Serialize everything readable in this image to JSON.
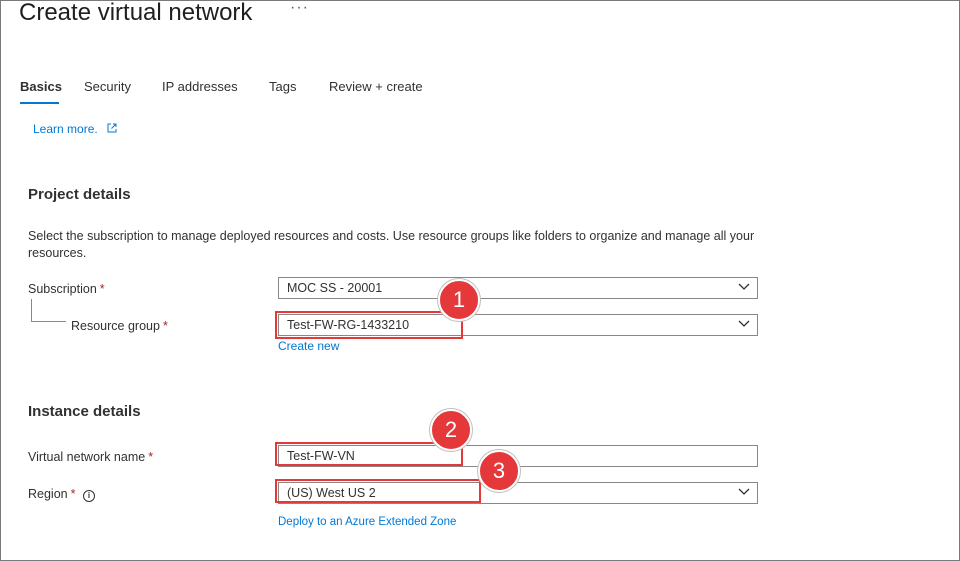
{
  "header": {
    "title": "Create virtual network",
    "more": "···"
  },
  "tabs": [
    {
      "label": "Basics",
      "active": true
    },
    {
      "label": "Security"
    },
    {
      "label": "IP addresses"
    },
    {
      "label": "Tags"
    },
    {
      "label": "Review + create"
    }
  ],
  "learn_more": "Learn more.",
  "project": {
    "heading": "Project details",
    "description": "Select the subscription to manage deployed resources and costs. Use resource groups like folders to organize and manage all your resources.",
    "subscription_label": "Subscription",
    "subscription_value": "MOC SS - 20001",
    "resource_group_label": "Resource group",
    "resource_group_value": "Test-FW-RG-1433210",
    "create_new": "Create new"
  },
  "instance": {
    "heading": "Instance details",
    "vnet_name_label": "Virtual network name",
    "vnet_name_value": "Test-FW-VN",
    "region_label": "Region",
    "region_value": "(US) West US 2",
    "extended_zone_link": "Deploy to an Azure Extended Zone"
  },
  "required_mark": "*",
  "info_glyph": "i",
  "callouts": [
    "1",
    "2",
    "3"
  ],
  "colors": {
    "accent": "#0078d4",
    "callout": "#e5383b",
    "required": "#a4262c"
  }
}
